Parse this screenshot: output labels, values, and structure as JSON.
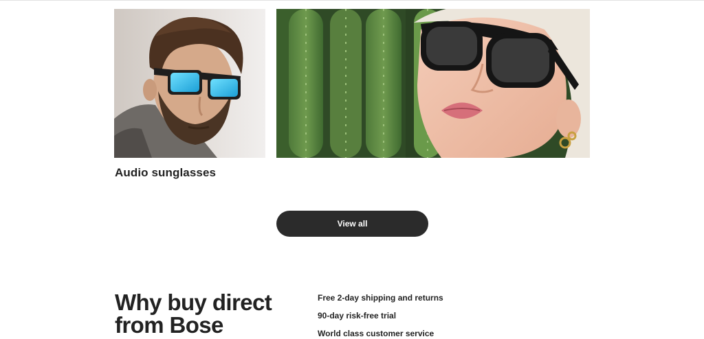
{
  "products": {
    "caption": "Audio sunglasses",
    "images": [
      {
        "subject": "man-with-blue-lens-audio-sunglasses"
      },
      {
        "subject": "woman-with-black-audio-sunglasses-cactus-background"
      }
    ]
  },
  "cta": {
    "view_all_label": "View all"
  },
  "why_buy": {
    "title": "Why buy direct from Bose",
    "benefits": [
      "Free 2-day shipping and returns",
      "90-day risk-free trial",
      "World class customer service"
    ]
  },
  "colors": {
    "text": "#222222",
    "button_bg": "#2b2b2b",
    "button_text": "#ffffff",
    "lens_blue": "#2bb8e8"
  }
}
